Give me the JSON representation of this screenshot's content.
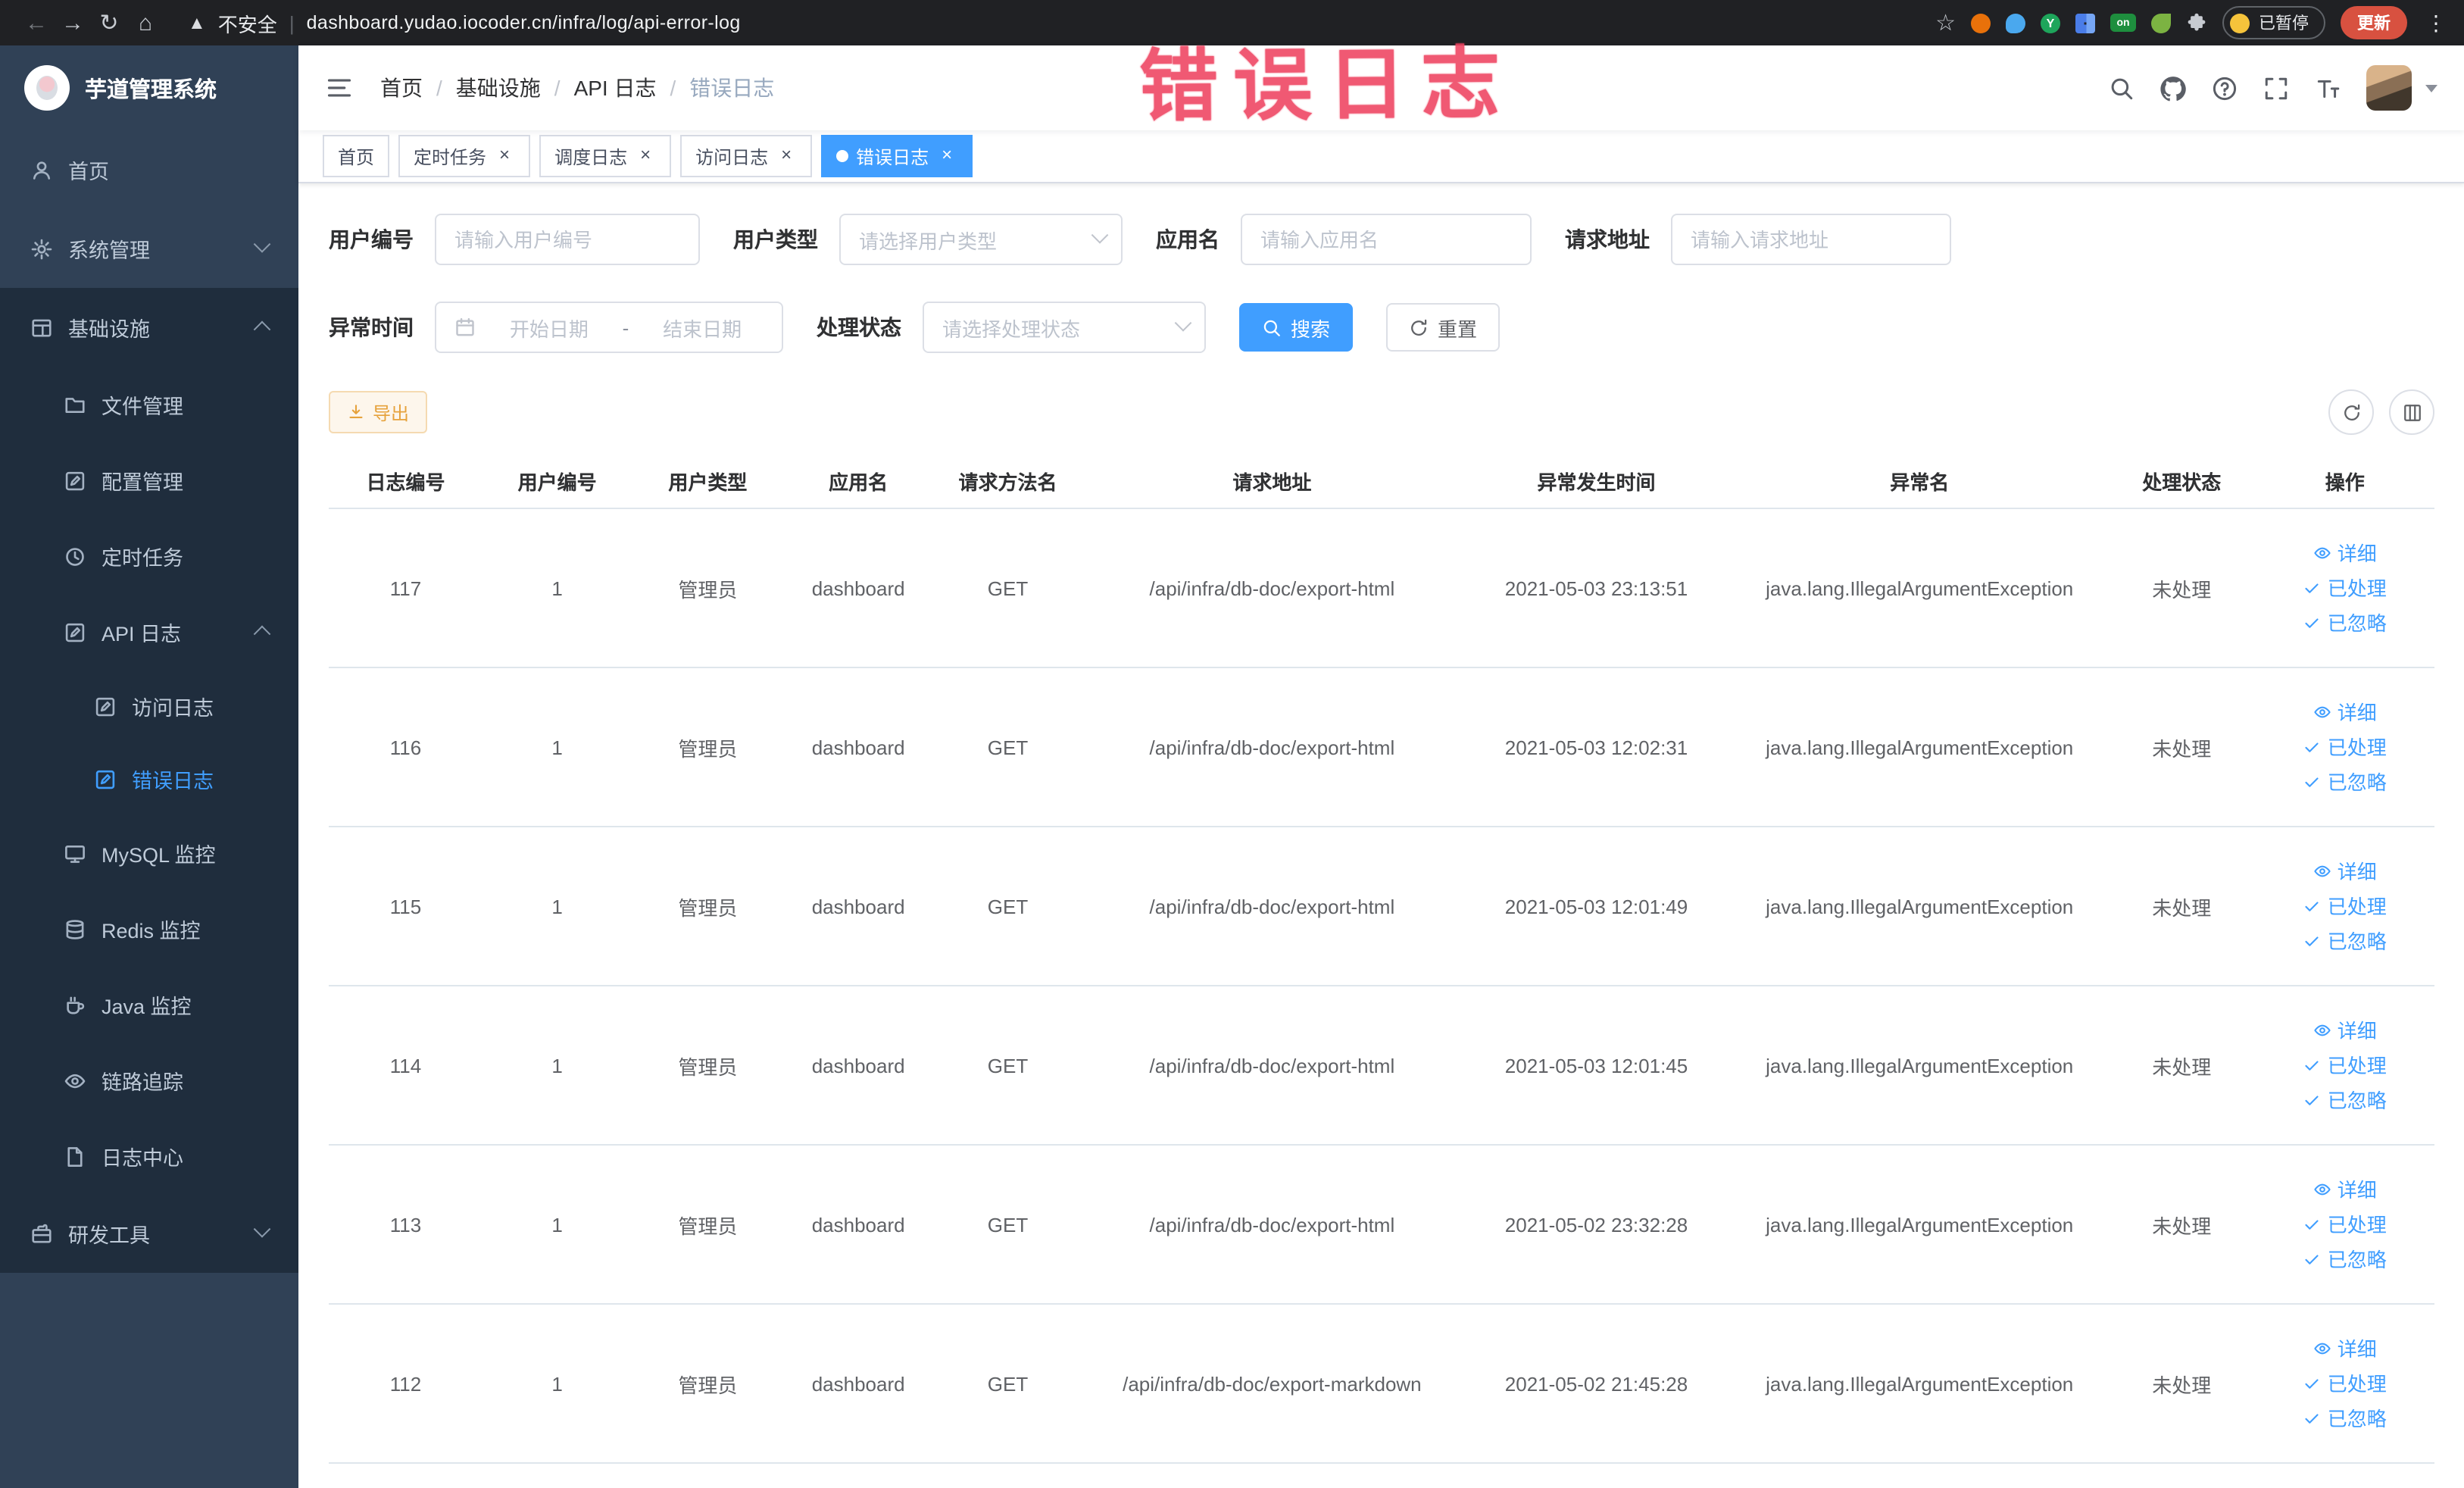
{
  "browser": {
    "security_label": "不安全",
    "url": "dashboard.yudao.iocoder.cn/infra/log/api-error-log",
    "paused_chip": "已暂停",
    "update_button": "更新",
    "extension_on_badge": "on",
    "extension_y_badge": "Y"
  },
  "annotation": {
    "text": "错误日志"
  },
  "sidebar": {
    "title": "芋道管理系统",
    "items": [
      {
        "id": "home",
        "label": "首页",
        "level": 1,
        "icon": "user"
      },
      {
        "id": "system",
        "label": "系统管理",
        "level": 1,
        "icon": "gear",
        "arrow": "down"
      },
      {
        "id": "infra",
        "label": "基础设施",
        "level": 1,
        "icon": "grid",
        "arrow": "up",
        "dark": true
      },
      {
        "id": "file",
        "label": "文件管理",
        "level": 2,
        "icon": "folder"
      },
      {
        "id": "config",
        "label": "配置管理",
        "level": 2,
        "icon": "editsq"
      },
      {
        "id": "job",
        "label": "定时任务",
        "level": 2,
        "icon": "clock"
      },
      {
        "id": "api-log",
        "label": "API 日志",
        "level": 2,
        "icon": "editsq",
        "arrow": "up"
      },
      {
        "id": "access-log",
        "label": "访问日志",
        "level": 3,
        "icon": "editsq"
      },
      {
        "id": "error-log",
        "label": "错误日志",
        "level": 3,
        "icon": "editsq",
        "active": true
      },
      {
        "id": "mysql",
        "label": "MySQL 监控",
        "level": 2,
        "icon": "monitor"
      },
      {
        "id": "redis",
        "label": "Redis 监控",
        "level": 2,
        "icon": "database"
      },
      {
        "id": "java",
        "label": "Java 监控",
        "level": 2,
        "icon": "coffee"
      },
      {
        "id": "trace",
        "label": "链路追踪",
        "level": 2,
        "icon": "eye"
      },
      {
        "id": "log-center",
        "label": "日志中心",
        "level": 2,
        "icon": "doc"
      },
      {
        "id": "dev-tools",
        "label": "研发工具",
        "level": 1,
        "icon": "tools",
        "arrow": "down",
        "dark": true
      }
    ]
  },
  "header": {
    "breadcrumb": [
      "首页",
      "基础设施",
      "API 日志",
      "错误日志"
    ]
  },
  "tabs": [
    {
      "id": "home",
      "label": "首页",
      "closable": false,
      "active": false
    },
    {
      "id": "job",
      "label": "定时任务",
      "closable": true,
      "active": false
    },
    {
      "id": "job-log",
      "label": "调度日志",
      "closable": true,
      "active": false
    },
    {
      "id": "access-log",
      "label": "访问日志",
      "closable": true,
      "active": false
    },
    {
      "id": "error-log",
      "label": "错误日志",
      "closable": true,
      "active": true
    }
  ],
  "filters": {
    "user_id": {
      "label": "用户编号",
      "placeholder": "请输入用户编号"
    },
    "user_type": {
      "label": "用户类型",
      "placeholder": "请选择用户类型"
    },
    "app_name": {
      "label": "应用名",
      "placeholder": "请输入应用名"
    },
    "request_url": {
      "label": "请求地址",
      "placeholder": "请输入请求地址"
    },
    "exception_time": {
      "label": "异常时间",
      "start_placeholder": "开始日期",
      "separator": "-",
      "end_placeholder": "结束日期"
    },
    "process_status": {
      "label": "处理状态",
      "placeholder": "请选择处理状态"
    },
    "search_button": "搜索",
    "reset_button": "重置"
  },
  "toolbar": {
    "export_button": "导出"
  },
  "table": {
    "columns": [
      "日志编号",
      "用户编号",
      "用户类型",
      "应用名",
      "请求方法名",
      "请求地址",
      "异常发生时间",
      "异常名",
      "处理状态",
      "操作"
    ],
    "row_actions": [
      {
        "id": "detail",
        "label": "详细",
        "icon": "eye"
      },
      {
        "id": "processed",
        "label": "已处理",
        "icon": "check"
      },
      {
        "id": "ignored",
        "label": "已忽略",
        "icon": "check"
      }
    ],
    "rows": [
      {
        "log_id": "117",
        "user_id": "1",
        "user_type": "管理员",
        "app": "dashboard",
        "method": "GET",
        "url": "/api/infra/db-doc/export-html",
        "time": "2021-05-03 23:13:51",
        "exception": "java.lang.IllegalArgumentException",
        "status": "未处理"
      },
      {
        "log_id": "116",
        "user_id": "1",
        "user_type": "管理员",
        "app": "dashboard",
        "method": "GET",
        "url": "/api/infra/db-doc/export-html",
        "time": "2021-05-03 12:02:31",
        "exception": "java.lang.IllegalArgumentException",
        "status": "未处理"
      },
      {
        "log_id": "115",
        "user_id": "1",
        "user_type": "管理员",
        "app": "dashboard",
        "method": "GET",
        "url": "/api/infra/db-doc/export-html",
        "time": "2021-05-03 12:01:49",
        "exception": "java.lang.IllegalArgumentException",
        "status": "未处理"
      },
      {
        "log_id": "114",
        "user_id": "1",
        "user_type": "管理员",
        "app": "dashboard",
        "method": "GET",
        "url": "/api/infra/db-doc/export-html",
        "time": "2021-05-03 12:01:45",
        "exception": "java.lang.IllegalArgumentException",
        "status": "未处理"
      },
      {
        "log_id": "113",
        "user_id": "1",
        "user_type": "管理员",
        "app": "dashboard",
        "method": "GET",
        "url": "/api/infra/db-doc/export-html",
        "time": "2021-05-02 23:32:28",
        "exception": "java.lang.IllegalArgumentException",
        "status": "未处理"
      },
      {
        "log_id": "112",
        "user_id": "1",
        "user_type": "管理员",
        "app": "dashboard",
        "method": "GET",
        "url": "/api/infra/db-doc/export-markdown",
        "time": "2021-05-02 21:45:28",
        "exception": "java.lang.IllegalArgumentException",
        "status": "未处理"
      }
    ]
  }
}
